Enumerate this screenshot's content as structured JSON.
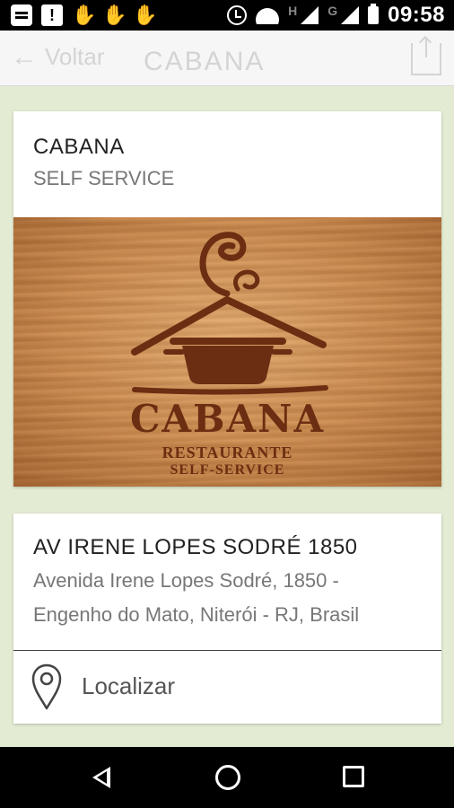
{
  "status_bar": {
    "time": "09:58",
    "network_h": "H",
    "network_g": "G",
    "icons": [
      "notification-icon",
      "alert-icon",
      "hand-icon",
      "hand-icon",
      "hand-icon",
      "alarm-icon",
      "wifi-icon",
      "signal-icon",
      "signal-icon",
      "battery-icon"
    ]
  },
  "app_bar": {
    "back_label": "Voltar",
    "title": "CABANA"
  },
  "restaurant_card": {
    "title": "CABANA",
    "subtitle": "SELF SERVICE",
    "banner": {
      "logo_name": "CABANA",
      "logo_line1": "RESTAURANTE",
      "logo_line2": "SELF-SERVICE"
    }
  },
  "address_card": {
    "title": "AV IRENE LOPES SODRÉ 1850",
    "address_line1": "Avenida Irene Lopes Sodré, 1850 -",
    "address_line2": "Engenho do Mato, Niterói - RJ, Brasil",
    "locate_label": "Localizar"
  },
  "colors": {
    "background": "#e3ecd2",
    "card": "#ffffff",
    "title_text": "#222222",
    "secondary_text": "#777777",
    "logo_brown": "#6b2e12"
  }
}
